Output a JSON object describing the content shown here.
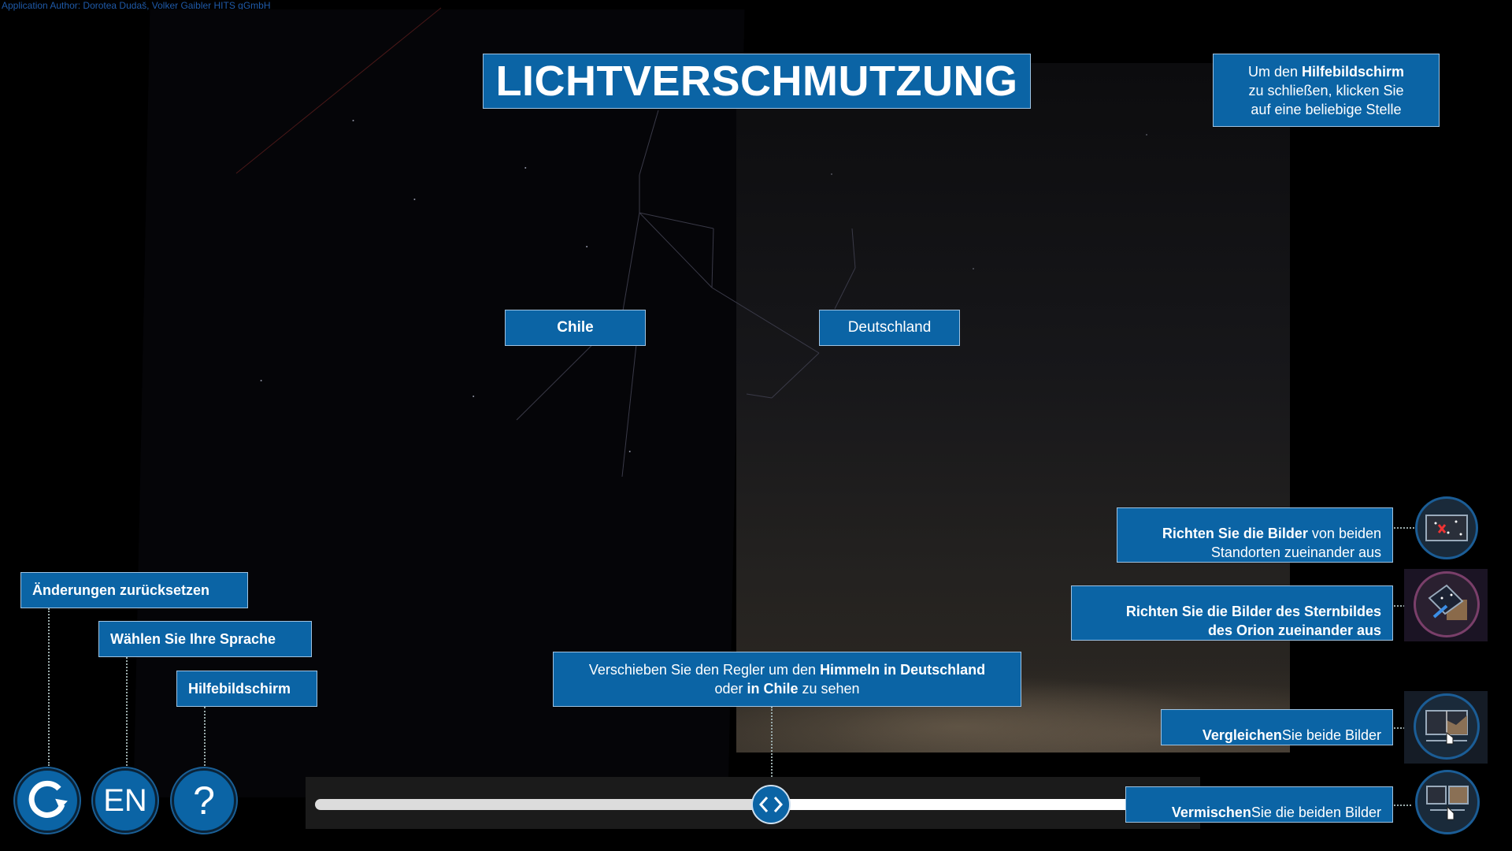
{
  "author": "Application Author: Dorotea Dudaš, Volker Gaibler HITS gGmbH",
  "title": "LICHTVERSCHMUTZUNG",
  "help_close": {
    "line1_pre": "Um den ",
    "line1_bold": "Hilfebildschirm",
    "line2": "zu schließen, klicken Sie",
    "line3": "auf eine beliebige Stelle"
  },
  "labels": {
    "chile": "Chile",
    "deutschland": "Deutschland"
  },
  "left_tips": {
    "reset": "Änderungen zurücksetzen",
    "language": "Wählen Sie Ihre Sprache",
    "help": "Hilfebildschirm"
  },
  "buttons": {
    "language_label": "EN",
    "help_label": "?"
  },
  "slider_tip": {
    "line1_pre": "Verschieben Sie den Regler um den ",
    "line1_bold1": "Himmeln",
    "line1_mid": " ",
    "line1_bold2": "in Deutschland",
    "line2_pre": "oder ",
    "line2_bold": "in Chile",
    "line2_post": " zu sehen"
  },
  "right_tips": {
    "align_sites_bold": "Richten Sie die Bilder",
    "align_sites_rest1": " von beiden",
    "align_sites_rest2": "Standorten zueinander aus",
    "align_orion_line1": "Richten Sie die Bilder des Sternbildes",
    "align_orion_line2": "des Orion zueinander aus",
    "compare_bold": "Vergleichen",
    "compare_rest": " Sie beide Bilder",
    "blend_bold": "Vermischen",
    "blend_rest": " Sie die beiden Bilder"
  },
  "slider": {
    "position": 0.53
  },
  "colors": {
    "accent": "#0b64a5",
    "background": "#000000"
  },
  "icons": [
    "reset-icon",
    "chevron-left-icon",
    "chevron-right-icon",
    "align-sites-icon",
    "align-orion-icon",
    "compare-icon",
    "blend-icon",
    "hand-pointer-icon"
  ]
}
